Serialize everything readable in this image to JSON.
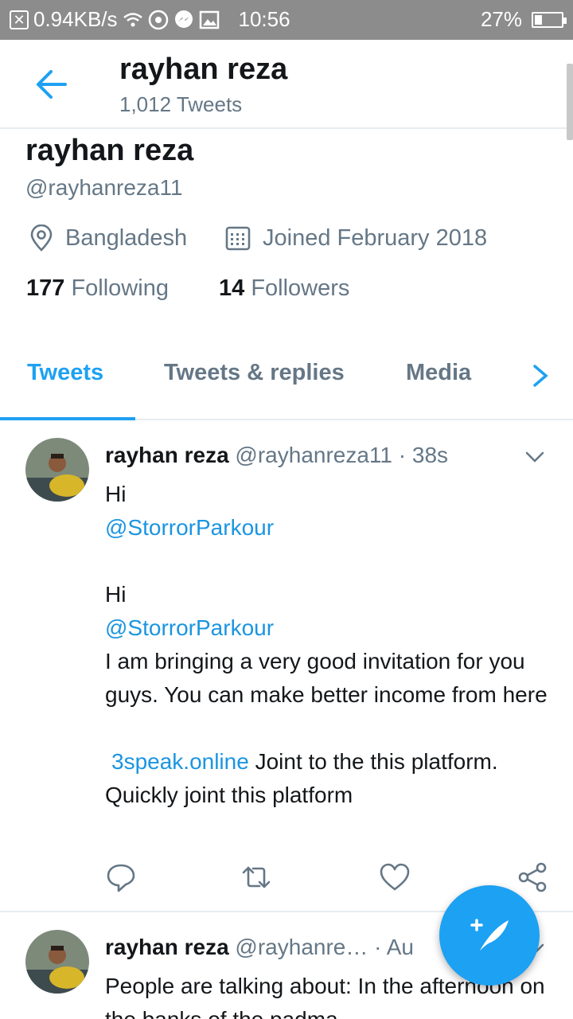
{
  "status_bar": {
    "speed": "0.94KB/s",
    "time": "10:56",
    "battery_percent": "27%",
    "battery_level": 0.27
  },
  "header": {
    "name": "rayhan reza",
    "tweet_count": "1,012 Tweets"
  },
  "profile": {
    "name": "rayhan reza",
    "handle": "@rayhanreza11",
    "location": "Bangladesh",
    "joined": "Joined February 2018",
    "following_count": "177",
    "following_label": "Following",
    "followers_count": "14",
    "followers_label": "Followers"
  },
  "tabs": [
    {
      "label": "Tweets",
      "active": true
    },
    {
      "label": "Tweets & replies",
      "active": false
    },
    {
      "label": "Media",
      "active": false
    }
  ],
  "tweets": [
    {
      "name": "rayhan reza",
      "handle": "@rayhanreza11",
      "time": "· 38s",
      "lines": {
        "l1": "Hi",
        "l2": "@StorrorParkour",
        "l3": "Hi",
        "l4": "@StorrorParkour",
        "l5": "I am bringing a very good invitation for you guys. You can make better income from here",
        "l6_link": "3speak.online",
        "l6_text": " Joint to the this platform. Quickly joint this platform"
      }
    },
    {
      "name": "rayhan reza",
      "handle": "@rayhanre…",
      "time": "· Au",
      "text": "People are talking about: In the afternoon on the banks of the padma"
    }
  ],
  "colors": {
    "accent": "#1da1f2",
    "link": "#1b95e0",
    "secondary_text": "#657786",
    "status_bar": "#8c8c8c"
  },
  "icons": [
    "back-arrow-icon",
    "location-icon",
    "calendar-icon",
    "chevron-right-icon",
    "chevron-down-icon",
    "reply-icon",
    "retweet-icon",
    "like-icon",
    "share-icon",
    "compose-icon"
  ]
}
